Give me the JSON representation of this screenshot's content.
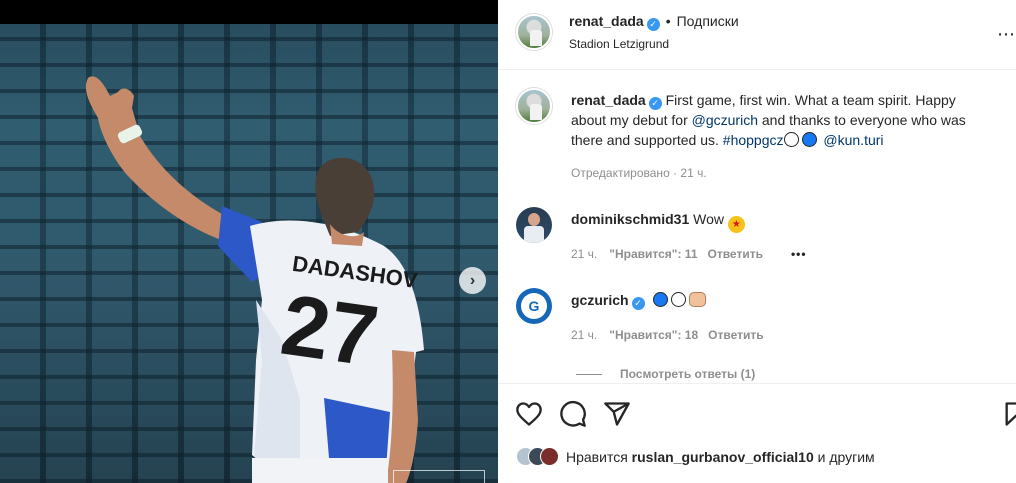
{
  "post": {
    "author": "renat_dada",
    "follow_label": "Подписки",
    "location": "Stadion Letzigrund",
    "more_icon": "more-horizontal-icon",
    "photo": {
      "jersey_name": "DADASHOV",
      "jersey_number": "27",
      "next_icon": "chevron-right-icon"
    }
  },
  "caption": {
    "author": "renat_dada",
    "text_1": "First game, first win. What a team spirit. Happy about my debut for ",
    "mention_1": "@gczurich",
    "text_2": " and thanks to everyone who was there and supported us. ",
    "hashtag": "#hoppgcz",
    "mention_2": "@kun.turi",
    "meta": "Отредактировано · 21 ч."
  },
  "comments": [
    {
      "author": "dominikschmid31",
      "text": "Wow",
      "time": "21 ч.",
      "likes": "\"Нравится\": 11",
      "reply": "Ответить",
      "more": "•••"
    },
    {
      "author": "gczurich",
      "text": "",
      "time": "21 ч.",
      "likes": "\"Нравится\": 18",
      "reply": "Ответить"
    }
  ],
  "view_replies": "Посмотреть ответы (1)",
  "actions": {
    "like_icon": "heart-icon",
    "comment_icon": "comment-icon",
    "share_icon": "send-icon",
    "save_icon": "bookmark-icon"
  },
  "likes_summary": {
    "prefix": "Нравится",
    "user": "ruslan_gurbanov_official10",
    "suffix": "и другим"
  },
  "colors": {
    "link": "#00376b",
    "verified": "#3897f0",
    "muted": "#8e8e8e"
  }
}
